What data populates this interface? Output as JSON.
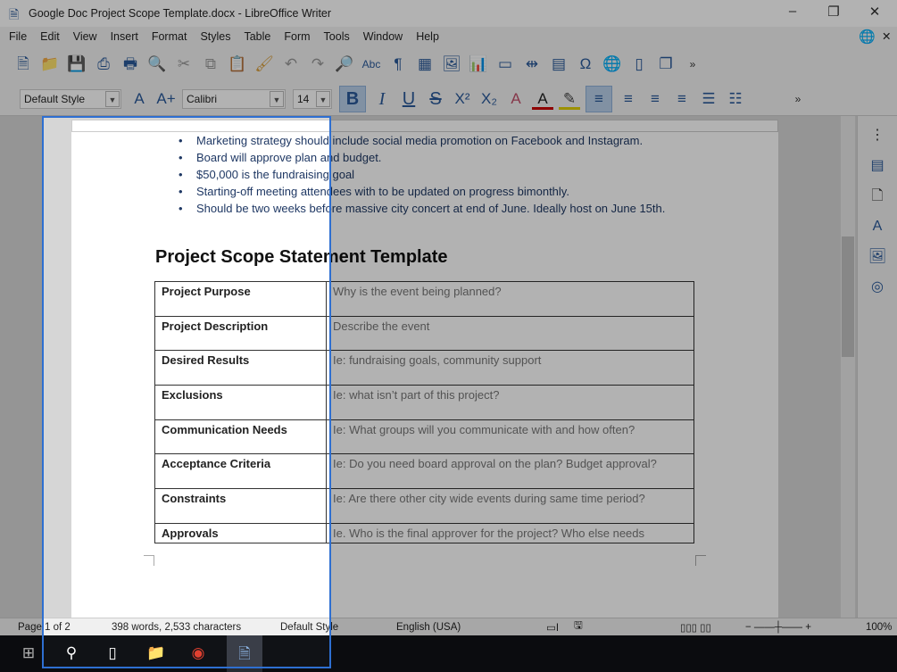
{
  "window": {
    "title": "Google Doc Project Scope Template.docx - LibreOffice Writer"
  },
  "menu": [
    "File",
    "Edit",
    "View",
    "Insert",
    "Format",
    "Styles",
    "Table",
    "Form",
    "Tools",
    "Window",
    "Help"
  ],
  "format_bar": {
    "paragraph_style": "Default Style",
    "font_name": "Calibri",
    "font_size": "14"
  },
  "document": {
    "bullets": [
      "Marketing strategy should include social media promotion on Facebook and Instagram.",
      "Board will approve plan and budget.",
      "$50,000 is the fundraising goal",
      "Starting-off meeting attendees with to be updated on progress bimonthly.",
      "Should be two weeks before massive city concert at end of June. Ideally host on June 15th."
    ],
    "heading": "Project Scope Statement Template",
    "table": [
      {
        "label": "Project Purpose",
        "hint": "Why is the event being planned?"
      },
      {
        "label": "Project Description",
        "hint": "Describe the event"
      },
      {
        "label": "Desired Results",
        "hint": "Ie: fundraising goals, community support"
      },
      {
        "label": "Exclusions",
        "hint": "Ie: what isn’t part of this project?"
      },
      {
        "label": "Communication Needs",
        "hint": "Ie: What groups will you communicate with and how often?"
      },
      {
        "label": "Acceptance Criteria",
        "hint": "Ie: Do you need board approval on the plan? Budget approval?"
      },
      {
        "label": "Constraints",
        "hint": "Ie: Are there other city wide events during same time period?"
      },
      {
        "label": "Approvals",
        "hint": "Ie. Who is the final approver for the project? Who else needs"
      }
    ]
  },
  "status": {
    "page": "Page 1 of 2",
    "words": "398 words, 2,533 characters",
    "style": "Default Style",
    "language": "English (USA)",
    "zoom": "100%"
  },
  "colors": {
    "selection_border": "#2e6fd1",
    "bullet_text": "#1f3864"
  }
}
